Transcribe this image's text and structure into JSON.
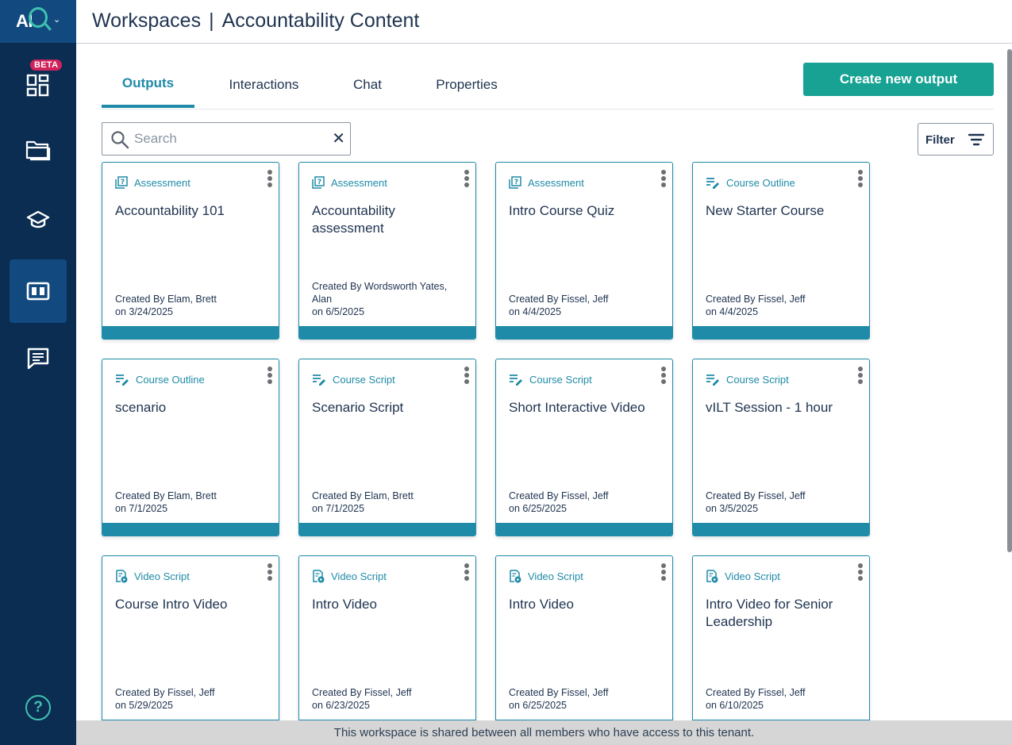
{
  "logo": {
    "text": "AI"
  },
  "sidebar": {
    "beta_badge": "BETA",
    "items": [
      {
        "name": "dashboard",
        "icon": "dashboard-icon"
      },
      {
        "name": "files",
        "icon": "folder-icon"
      },
      {
        "name": "learning",
        "icon": "graduation-cap-icon"
      },
      {
        "name": "workspaces",
        "icon": "workspace-icon",
        "active": true
      },
      {
        "name": "chat",
        "icon": "chat-icon"
      }
    ],
    "help": "?"
  },
  "header": {
    "section": "Workspaces",
    "separator": "|",
    "workspace": "Accountability Content"
  },
  "tabs": [
    {
      "label": "Outputs",
      "active": true
    },
    {
      "label": "Interactions",
      "active": false
    },
    {
      "label": "Chat",
      "active": false
    },
    {
      "label": "Properties",
      "active": false
    }
  ],
  "actions": {
    "create_label": "Create new output"
  },
  "search": {
    "placeholder": "Search",
    "value": "",
    "clear": "✕"
  },
  "filter": {
    "label": "Filter"
  },
  "cards": [
    {
      "type": "Assessment",
      "icon": "assessment-icon",
      "title": "Accountability 101",
      "created_by": "Created By Elam, Brett",
      "created_on": "on 3/24/2025"
    },
    {
      "type": "Assessment",
      "icon": "assessment-icon",
      "title": "Accountability assessment",
      "created_by": "Created By Wordsworth Yates, Alan",
      "created_on": "on 6/5/2025"
    },
    {
      "type": "Assessment",
      "icon": "assessment-icon",
      "title": "Intro Course Quiz",
      "created_by": "Created By Fissel, Jeff",
      "created_on": "on 4/4/2025"
    },
    {
      "type": "Course Outline",
      "icon": "edit-list-icon",
      "title": "New Starter Course",
      "created_by": "Created By Fissel, Jeff",
      "created_on": "on 4/4/2025"
    },
    {
      "type": "Course Outline",
      "icon": "edit-list-icon",
      "title": "scenario",
      "created_by": "Created By Elam, Brett",
      "created_on": "on 7/1/2025"
    },
    {
      "type": "Course Script",
      "icon": "edit-list-icon",
      "title": "Scenario Script",
      "created_by": "Created By Elam, Brett",
      "created_on": "on 7/1/2025"
    },
    {
      "type": "Course Script",
      "icon": "edit-list-icon",
      "title": "Short Interactive Video",
      "created_by": "Created By Fissel, Jeff",
      "created_on": "on 6/25/2025"
    },
    {
      "type": "Course Script",
      "icon": "edit-list-icon",
      "title": "vILT Session - 1 hour",
      "created_by": "Created By Fissel, Jeff",
      "created_on": "on 3/5/2025"
    },
    {
      "type": "Video Script",
      "icon": "video-doc-icon",
      "title": "Course Intro Video",
      "created_by": "Created By Fissel, Jeff",
      "created_on": "on 5/29/2025"
    },
    {
      "type": "Video Script",
      "icon": "video-doc-icon",
      "title": "Intro Video",
      "created_by": "Created By Fissel, Jeff",
      "created_on": "on 6/23/2025"
    },
    {
      "type": "Video Script",
      "icon": "video-doc-icon",
      "title": "Intro Video",
      "created_by": "Created By Fissel, Jeff",
      "created_on": "on 6/25/2025"
    },
    {
      "type": "Video Script",
      "icon": "video-doc-icon",
      "title": "Intro Video for Senior Leadership",
      "created_by": "Created By Fissel, Jeff",
      "created_on": "on 6/10/2025"
    }
  ],
  "footer": {
    "notice": "This workspace is shared between all members who have access to this tenant."
  },
  "colors": {
    "sidebar_bg": "#0b2d52",
    "sidebar_active": "#124a80",
    "accent": "#1f8ba8",
    "primary_button": "#17a294",
    "beta_badge": "#d1225c",
    "logo_accent": "#3fc2b0"
  }
}
